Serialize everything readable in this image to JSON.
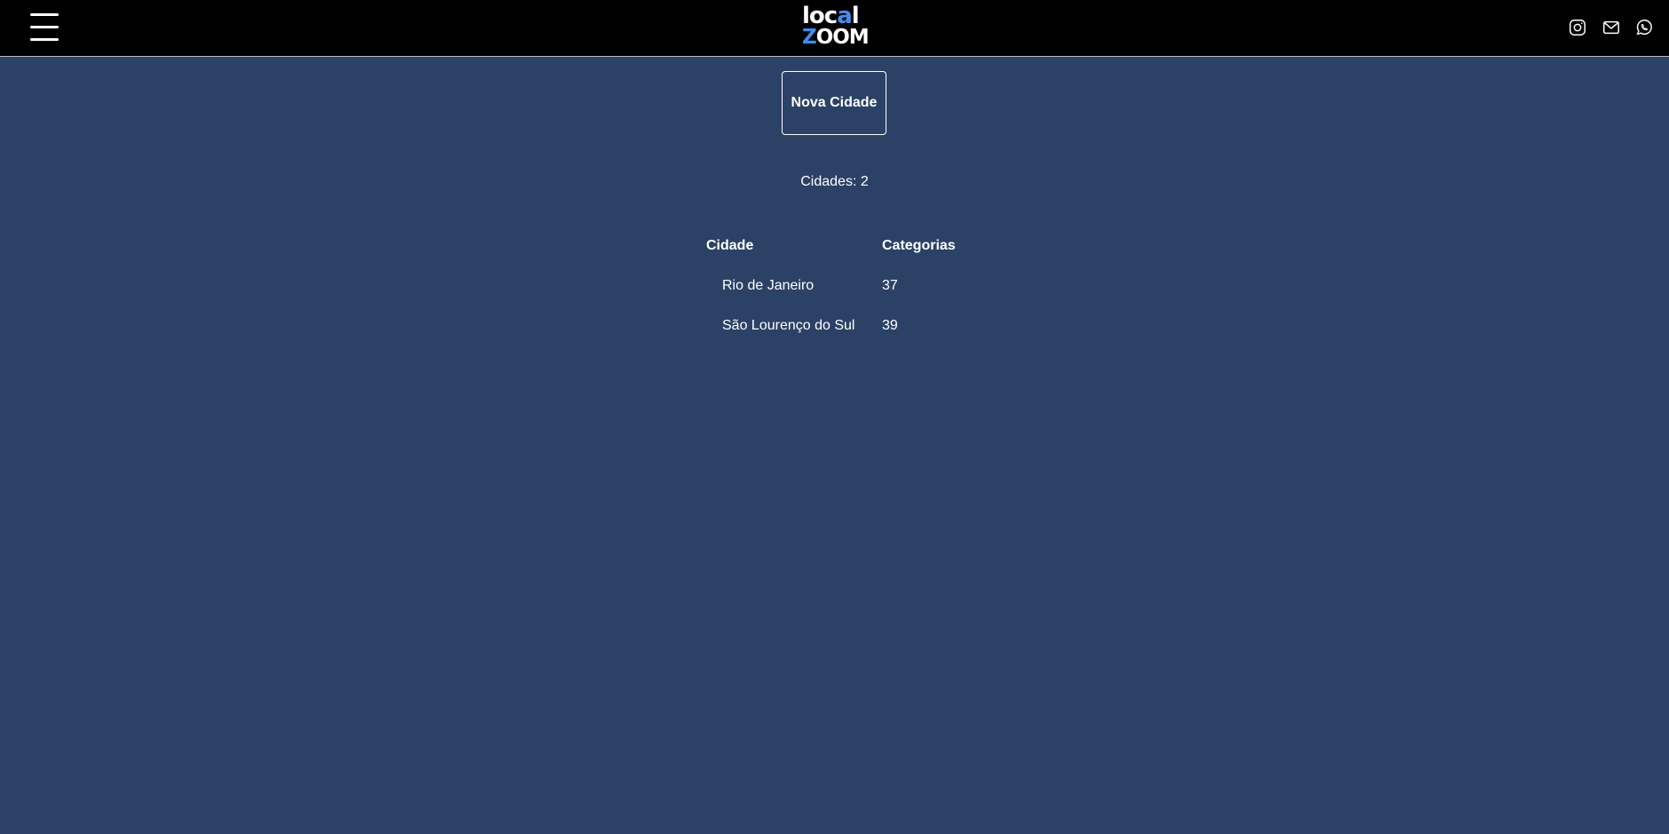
{
  "header": {
    "logo": {
      "line1_a": "loc",
      "line1_b": "a",
      "line1_c": "l",
      "line2_a": "Z",
      "line2_b": "OOM"
    },
    "menu_icon": "hamburger-menu-icon",
    "social_icons": [
      "instagram-icon",
      "mail-icon",
      "whatsapp-icon"
    ]
  },
  "actions": {
    "new_city_label": "Nova Cidade"
  },
  "summary": {
    "count_text": "Cidades: 2"
  },
  "table": {
    "columns": [
      "Cidade",
      "Categorias"
    ],
    "rows": [
      {
        "city": "Rio de Janeiro",
        "categories": "37"
      },
      {
        "city": "São Lourenço do Sul",
        "categories": "39"
      }
    ]
  },
  "colors": {
    "background": "#2c4166",
    "topbar": "#000000",
    "logo_accent": "#3d8ef0",
    "text": "#ffffff"
  }
}
